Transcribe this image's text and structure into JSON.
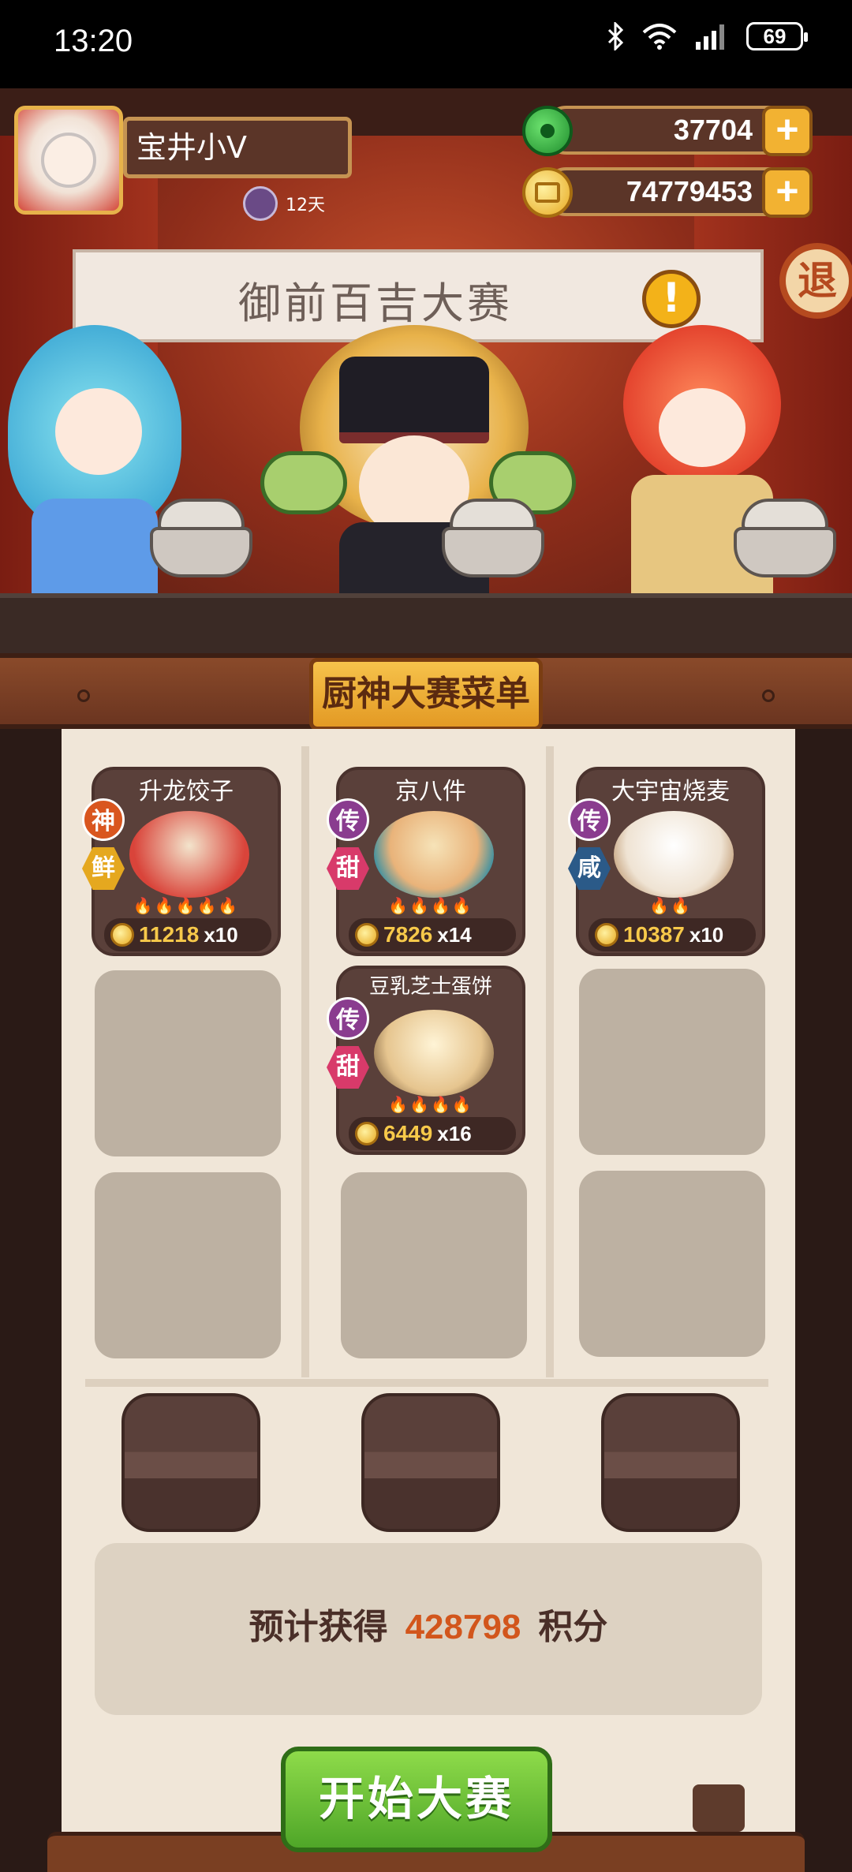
{
  "status_bar": {
    "time": "13:20",
    "battery": "69"
  },
  "player": {
    "name": "宝井小V",
    "days": "12天"
  },
  "currency": {
    "jade": "37704",
    "coins": "74779453",
    "add_label": "+"
  },
  "event": {
    "title": "御前百吉大赛",
    "alert": "!",
    "exit_label": "退"
  },
  "menu": {
    "title": "厨神大赛菜单",
    "dishes": [
      {
        "name": "升龙饺子",
        "badge1": "神",
        "badge2": "鲜",
        "flames": "🔥🔥🔥🔥🔥",
        "price": "11218",
        "qty": "x10",
        "plate_color": "#d9443a"
      },
      {
        "name": "京八件",
        "badge1": "传",
        "badge2": "甜",
        "flames": "🔥🔥🔥🔥",
        "price": "7826",
        "qty": "x14",
        "plate_color": "#e9b37a"
      },
      {
        "name": "大宇宙烧麦",
        "badge1": "传",
        "badge2": "咸",
        "flames": "🔥🔥",
        "price": "10387",
        "qty": "x10",
        "plate_color": "#efe3d3"
      },
      {
        "name": "豆乳芝士蛋饼",
        "badge1": "传",
        "badge2": "甜",
        "flames": "🔥🔥🔥🔥",
        "price": "6449",
        "qty": "x16",
        "plate_color": "#e6c58f"
      }
    ]
  },
  "score": {
    "prefix": "预计获得",
    "value": "428798",
    "suffix": "积分"
  },
  "start_button": "开始大赛",
  "colors": {
    "badge_shen": "#d9561f",
    "badge_chuan": "#8a3c8f",
    "badge_xian": "#e5a81f",
    "badge_tian": "#d83a6a",
    "badge_xian_salty": "#2b5a88"
  }
}
